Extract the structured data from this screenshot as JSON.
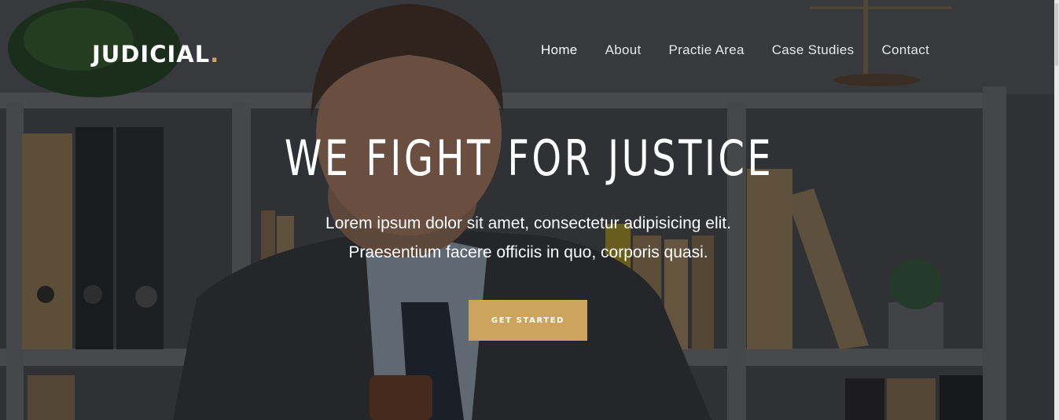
{
  "brand": {
    "name": "JUDICIAL",
    "dot": ".",
    "accent_color": "#cda45e"
  },
  "nav": {
    "items": [
      {
        "label": "Home",
        "active": true
      },
      {
        "label": "About"
      },
      {
        "label": "Practie Area"
      },
      {
        "label": "Case Studies"
      },
      {
        "label": "Contact"
      }
    ]
  },
  "hero": {
    "title": "WE FIGHT FOR JUSTICE",
    "subtitle_line1": "Lorem ipsum dolor sit amet, consectetur adipisicing elit.",
    "subtitle_line2": "Praesentium facere officiis in quo, corporis quasi.",
    "cta_label": "GET STARTED",
    "background_image": "lawyer-in-office-photo"
  }
}
